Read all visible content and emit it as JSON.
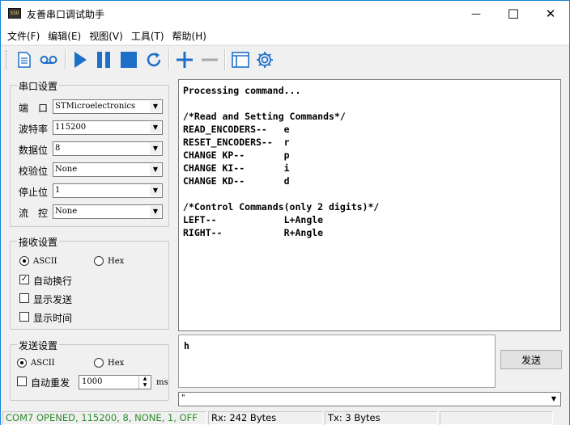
{
  "window": {
    "title": "友善串口调试助手",
    "icon_text": "SSU",
    "minimize_glyph": "—",
    "maximize_glyph": "☐",
    "close_glyph": "✕"
  },
  "menu": [
    "文件(F)",
    "编辑(E)",
    "视图(V)",
    "工具(T)",
    "帮助(H)"
  ],
  "toolbar": {
    "icons": [
      "document-icon",
      "record-icon",
      "play-icon",
      "pause-icon",
      "stop-icon",
      "refresh-icon",
      "add-icon",
      "remove-icon",
      "window-icon",
      "gear-icon"
    ],
    "accent": "#1e6fc8"
  },
  "serial_settings": {
    "legend": "串口设置",
    "rows": [
      {
        "label": "端　口",
        "value": "STMicroelectronics"
      },
      {
        "label": "波特率",
        "value": "115200"
      },
      {
        "label": "数据位",
        "value": "8"
      },
      {
        "label": "校验位",
        "value": "None"
      },
      {
        "label": "停止位",
        "value": "1"
      },
      {
        "label": "流　控",
        "value": "None"
      }
    ]
  },
  "receive_settings": {
    "legend": "接收设置",
    "ascii": "ASCII",
    "hex": "Hex",
    "auto_wrap": "自动换行",
    "show_send": "显示发送",
    "show_time": "显示时间"
  },
  "send_settings": {
    "legend": "发送设置",
    "ascii": "ASCII",
    "hex": "Hex",
    "auto_resend": "自动重发",
    "interval": "1000",
    "unit": "ms"
  },
  "receive_text": "Processing command...\n\n/*Read and Setting Commands*/\nREAD_ENCODERS--   e\nRESET_ENCODERS--  r\nCHANGE KP--       p\nCHANGE KI--       i\nCHANGE KD--       d\n\n/*Control Commands(only 2 digits)*/\nLEFT--            L+Angle\nRIGHT--           R+Angle",
  "send_text": "h",
  "send_button": "发送",
  "history_value": "\"",
  "status": {
    "port": "COM7 OPENED, 115200, 8, NONE, 1, OFF",
    "port_color": "#2e8b2e",
    "rx": "Rx: 242 Bytes",
    "tx": "Tx: 3 Bytes"
  }
}
